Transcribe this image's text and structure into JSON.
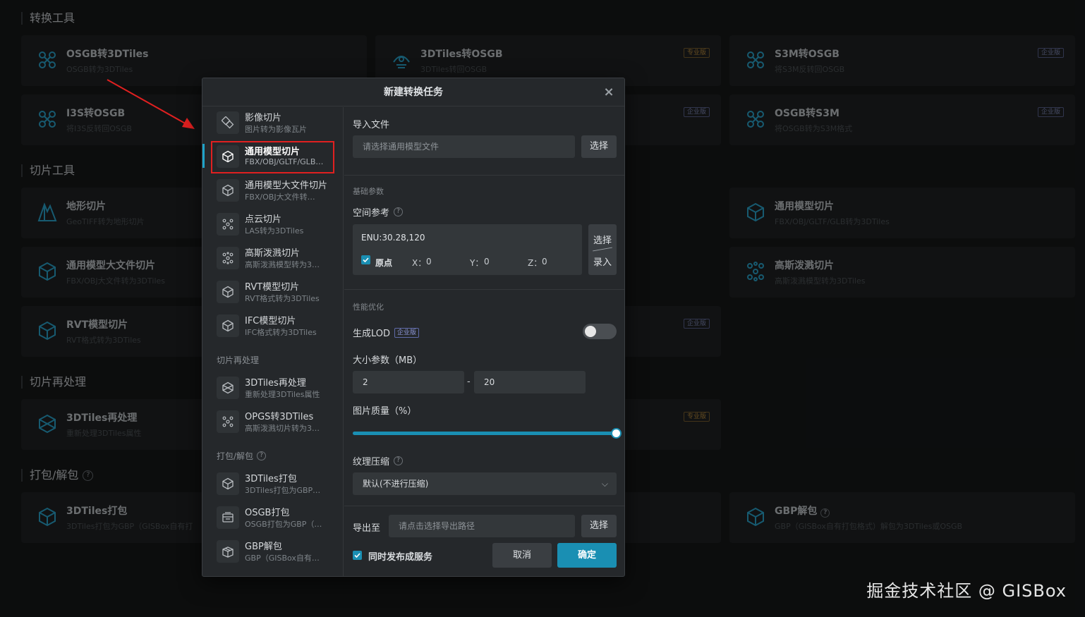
{
  "background": {
    "sections": {
      "convert": "转换工具",
      "slice": "切片工具",
      "reprocess": "切片再处理",
      "pack": "打包/解包"
    },
    "cards": {
      "osgb_3dtiles": {
        "title": "OSGB转3DTiles",
        "sub": "OSGB转为3DTiles"
      },
      "tiles_osgb": {
        "title": "3DTiles转OSGB",
        "sub": "3DTiles转回OSGB",
        "badge": "专业版"
      },
      "s3m_osgb": {
        "title": "S3M转OSGB",
        "sub": "将S3M反转回OSGB",
        "badge": "企业版"
      },
      "i3s_osgb": {
        "title": "I3S转OSGB",
        "sub": "将I3S反转回OSGB"
      },
      "mid_row2": {
        "badge": "企业版"
      },
      "osgb_s3m": {
        "title": "OSGB转S3M",
        "sub": "将OSGB转为S3M格式",
        "badge": "企业版"
      },
      "terrain": {
        "title": "地形切片",
        "sub": "GeoTIFF转为地形切片"
      },
      "model_right": {
        "title": "通用模型切片",
        "sub": "FBX/OBJ/GLTF/GLB转为3DTiles"
      },
      "bigmodel": {
        "title": "通用模型大文件切片",
        "sub": "FBX/OBJ大文件转为3DTiles"
      },
      "gaussian_right": {
        "title": "高斯泼溅切片",
        "sub": "高斯泼溅模型转为3DTiles"
      },
      "rvt": {
        "title": "RVT模型切片",
        "sub": "RVT格式转为3DTiles"
      },
      "mid_row5": {
        "badge": "企业版"
      },
      "reproc": {
        "title": "3DTiles再处理",
        "sub": "重新处理3DTiles属性"
      },
      "mid_row6": {
        "badge": "专业版"
      },
      "pack3d": {
        "title": "3DTiles打包",
        "sub": "3DTiles打包为GBP（GISBox自有打"
      },
      "gbp_unpack": {
        "title": "GBP解包",
        "sub": "GBP（GISBox自有打包格式）解包为3DTiles或OSGB"
      }
    }
  },
  "modal": {
    "title": "新建转换任务",
    "close": "×",
    "menu": [
      {
        "title": "影像切片",
        "sub": "图片转为影像瓦片",
        "icon": "image-tile-icon"
      },
      {
        "title": "通用模型切片",
        "sub": "FBX/OBJ/GLTF/GLB…",
        "icon": "cube-icon"
      },
      {
        "title": "通用模型大文件切片",
        "sub": "FBX/OBJ大文件转…",
        "icon": "cube-icon"
      },
      {
        "title": "点云切片",
        "sub": "LAS转为3DTiles",
        "icon": "point-cloud-icon"
      },
      {
        "title": "高斯泼溅切片",
        "sub": "高斯泼溅模型转为3…",
        "icon": "gaussian-icon"
      },
      {
        "title": "RVT模型切片",
        "sub": "RVT格式转为3DTiles",
        "icon": "cube-icon"
      },
      {
        "title": "IFC模型切片",
        "sub": "IFC格式转为3DTiles",
        "icon": "cube-icon"
      }
    ],
    "group_reprocess": "切片再处理",
    "menu_reprocess": [
      {
        "title": "3DTiles再处理",
        "sub": "重新处理3DTiles属性"
      },
      {
        "title": "OPGS转3DTiles",
        "sub": "高斯泼溅切片转为3…"
      }
    ],
    "group_pack": "打包/解包",
    "menu_pack": [
      {
        "title": "3DTiles打包",
        "sub": "3DTiles打包为GBP…"
      },
      {
        "title": "OSGB打包",
        "sub": "OSGB打包为GBP（…"
      },
      {
        "title": "GBP解包",
        "sub": "GBP（GISBox自有…"
      }
    ],
    "form": {
      "import_label": "导入文件",
      "import_placeholder": "请选择通用模型文件",
      "select": "选择",
      "basic_params": "基础参数",
      "spatial_ref": "空间参考",
      "enu": "ENU:30.28,120",
      "origin": "原点",
      "x_label": "X：",
      "x_value": "0",
      "y_label": "Y：",
      "y_value": "0",
      "z_label": "Z：",
      "z_value": "0",
      "pick_select": "选择",
      "pick_input": "录入",
      "perf": "性能优化",
      "lod_label": "生成LOD",
      "lod_badge": "企业版",
      "lod_enabled": false,
      "size_label": "大小参数（MB）",
      "size_min": "2",
      "size_dash": "-",
      "size_max": "20",
      "quality_label": "图片质量（%）",
      "quality_value": 100,
      "texture_label": "纹理压缩",
      "texture_value": "默认(不进行压缩)",
      "export_label": "导出至",
      "export_placeholder": "请点击选择导出路径",
      "publish_label": "同时发布成服务",
      "publish_checked": true,
      "cancel": "取消",
      "confirm": "确定"
    }
  },
  "watermark": "掘金技术社区 @ GISBox",
  "colors": {
    "accent": "#1a8fb3",
    "highlight_box": "#e02020",
    "arrow": "#e02020"
  }
}
